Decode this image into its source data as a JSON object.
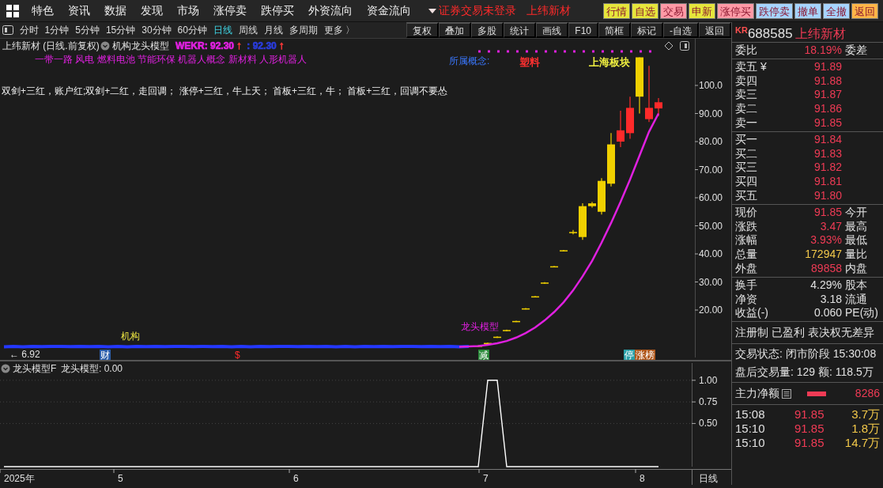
{
  "menu_bar": {
    "items": [
      "特色",
      "资讯",
      "数据",
      "发现",
      "市场",
      "涨停卖",
      "跌停买",
      "外资流向",
      "资金流向"
    ],
    "login_status": "证券交易未登录",
    "login_stock": "上纬新材",
    "quick_buttons": [
      {
        "label": "行情",
        "color": "#e6e63c"
      },
      {
        "label": "自选",
        "color": "#e6e63c"
      },
      {
        "label": "交易",
        "color": "#ff9aa6"
      },
      {
        "label": "申新",
        "color": "#e6e63c"
      },
      {
        "label": "涨停买",
        "color": "#ff9aa6"
      },
      {
        "label": "跌停卖",
        "color": "#a6d4ff"
      },
      {
        "label": "撤单",
        "color": "#a6d4ff"
      },
      {
        "label": "全撤",
        "color": "#a6d4ff"
      },
      {
        "label": "返回",
        "color": "#ffb648"
      }
    ]
  },
  "period_tabs": [
    {
      "label": "分时",
      "selected": false
    },
    {
      "label": "1分钟",
      "selected": false
    },
    {
      "label": "5分钟",
      "selected": false
    },
    {
      "label": "15分钟",
      "selected": false
    },
    {
      "label": "30分钟",
      "selected": false
    },
    {
      "label": "60分钟",
      "selected": false
    },
    {
      "label": "日线",
      "selected": true
    },
    {
      "label": "周线",
      "selected": false
    },
    {
      "label": "月线",
      "selected": false
    },
    {
      "label": "多周期",
      "selected": false
    },
    {
      "label": "更多 〉",
      "selected": false
    }
  ],
  "chart_tools": [
    "复权",
    "叠加",
    "多股",
    "统计",
    "画线",
    "F10",
    "简框",
    "标记",
    "-自选",
    "返回"
  ],
  "main_chart": {
    "title": "上纬新材 (日线.前复权)",
    "indicator": "机构龙头模型",
    "legend": [
      {
        "text": "WEKR: 92.30",
        "color": "#e020e0"
      },
      {
        "text": "↑",
        "color": "#ff3838"
      },
      {
        "text": " : 92.30",
        "color": "#2a3cd8"
      },
      {
        "text": "↑",
        "color": "#ff3838"
      }
    ],
    "concepts": "一带一路 风电 燃料电池 节能环保 机器人概念 新材料 人形机器人",
    "note": "双剑+三红，账户红;双剑+二红，走回调； 涨停+三红，牛上天； 首板+三红，牛； 首板+三红，回调不要怂",
    "concept_label": "所属概念:",
    "concept_tags": [
      {
        "text": "塑料",
        "color": "#ff3030"
      },
      {
        "text": "上海板块",
        "color": "#f0f040"
      }
    ],
    "price_axis": [
      "100.0",
      "90.00",
      "80.00",
      "70.00",
      "60.00",
      "50.00",
      "40.00",
      "30.00",
      "20.00"
    ],
    "low_label": "← 6.92",
    "chart_labels": [
      {
        "text": "机构",
        "color": "#e8e040"
      },
      {
        "text": "龙头模型",
        "color": "#e020e0"
      }
    ],
    "events": [
      {
        "text": "财",
        "kind": "tag",
        "color": "#2a5ca8"
      },
      {
        "text": "$",
        "kind": "mark",
        "color": "#ff2a2a"
      },
      {
        "text": "减",
        "kind": "tag",
        "color": "#2a8a3a"
      },
      {
        "text": "停",
        "kind": "tag",
        "color": "#2aa0a8"
      },
      {
        "text": "涨榜",
        "kind": "tag",
        "color": "#b0581c"
      }
    ]
  },
  "indicator_panel": {
    "title": "龙头模型F",
    "legend": "龙头模型: 0.00",
    "time_axis": [
      "2025年",
      "5",
      "6",
      "7",
      "8"
    ],
    "chart_data": {
      "type": "line",
      "ylim": [
        0,
        1.2
      ],
      "values": [
        0,
        0,
        0,
        0,
        0,
        0,
        0,
        0,
        0,
        0,
        0,
        0,
        0,
        0,
        0,
        0,
        0,
        0,
        0,
        0,
        0,
        0,
        0,
        0,
        0,
        0,
        0,
        0,
        0,
        0,
        0,
        0,
        0,
        0,
        0,
        0,
        0,
        0,
        0,
        0,
        0,
        0,
        0,
        0,
        0,
        0,
        0,
        0,
        0,
        0,
        0,
        1,
        1,
        0,
        0,
        0,
        0,
        0,
        0,
        0,
        0,
        0,
        0,
        0,
        0,
        0,
        0,
        0,
        0,
        0
      ],
      "grid": true,
      "yticks": [
        {
          "value": 1,
          "label": "1.00"
        },
        {
          "value": 0.75,
          "label": "0.75"
        },
        {
          "value": 0.5,
          "label": "0.50"
        }
      ]
    },
    "period_label": "日线"
  },
  "quote_panel": {
    "market": "KR",
    "code": "688585",
    "name": "上纬新材",
    "ratio": {
      "label": "委比",
      "value": "18.19%",
      "label2": "委差"
    },
    "asks": [
      {
        "label": "卖五 ¥",
        "price": "91.89"
      },
      {
        "label": "卖四",
        "price": "91.88"
      },
      {
        "label": "卖三",
        "price": "91.87"
      },
      {
        "label": "卖二",
        "price": "91.86"
      },
      {
        "label": "卖一",
        "price": "91.85"
      }
    ],
    "bids": [
      {
        "label": "买一",
        "price": "91.84"
      },
      {
        "label": "买二",
        "price": "91.83"
      },
      {
        "label": "买三",
        "price": "91.82"
      },
      {
        "label": "买四",
        "price": "91.81"
      },
      {
        "label": "买五",
        "price": "91.80"
      }
    ],
    "stats": [
      {
        "label": "现价",
        "value": "91.85",
        "color": "#ef3b55",
        "label2": "今开"
      },
      {
        "label": "涨跌",
        "value": "3.47",
        "color": "#ef3b55",
        "label2": "最高"
      },
      {
        "label": "涨幅",
        "value": "3.93%",
        "color": "#ef3b55",
        "label2": "最低"
      },
      {
        "label": "总量",
        "value": "172947",
        "color": "#f2c84a",
        "label2": "量比"
      },
      {
        "label": "外盘",
        "value": "89858",
        "color": "#ef3b55",
        "label2": "内盘"
      }
    ],
    "stats2": [
      {
        "label": "换手",
        "value": "4.29%",
        "color": "#e0e0e0",
        "label2": "股本"
      },
      {
        "label": "净资",
        "value": "3.18",
        "color": "#e0e0e0",
        "label2": "流通"
      },
      {
        "label": "收益(-)",
        "value": "0.060",
        "color": "#e0e0e0",
        "label2": "PE(动)"
      }
    ],
    "tags": "注册制 已盈利 表决权无差异",
    "trade_status": "交易状态: 闭市阶段 15:30:08",
    "after_hours": "盘后交易量: 129  额: 118.5万",
    "flow": {
      "label": "主力净额",
      "value": "8286"
    },
    "ticks": [
      {
        "time": "15:08",
        "price": "91.85",
        "volume": "3.7万"
      },
      {
        "time": "15:10",
        "price": "91.85",
        "volume": "1.8万"
      },
      {
        "time": "15:10",
        "price": "91.85",
        "volume": "14.7万"
      }
    ]
  }
}
